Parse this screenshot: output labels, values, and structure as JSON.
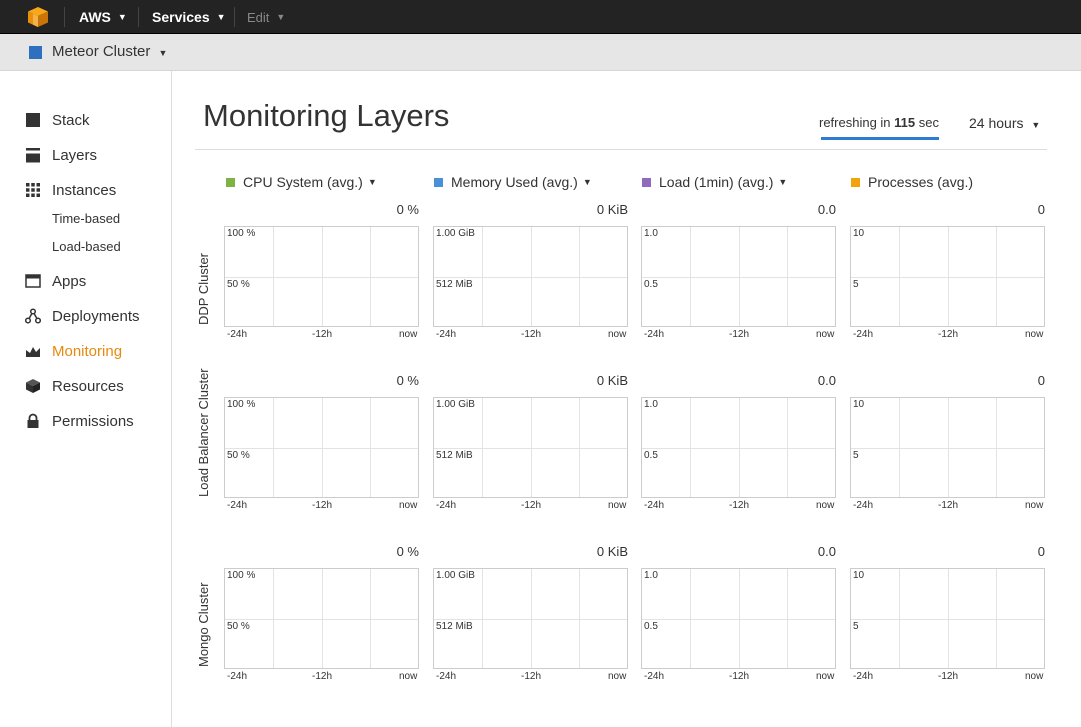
{
  "topbar": {
    "aws_label": "AWS",
    "services_label": "Services",
    "edit_label": "Edit"
  },
  "stack": {
    "name": "Meteor Cluster",
    "color": "#2e6fc0"
  },
  "sidebar": {
    "items": [
      {
        "label": "Stack",
        "icon": "stack-icon"
      },
      {
        "label": "Layers",
        "icon": "layers-icon"
      },
      {
        "label": "Instances",
        "icon": "instances-grid-icon"
      },
      {
        "label": "Apps",
        "icon": "apps-icon"
      },
      {
        "label": "Deployments",
        "icon": "deployments-icon"
      },
      {
        "label": "Monitoring",
        "icon": "monitoring-icon",
        "active": true
      },
      {
        "label": "Resources",
        "icon": "resources-cube-icon"
      },
      {
        "label": "Permissions",
        "icon": "lock-icon"
      }
    ],
    "instances_sub": [
      "Time-based",
      "Load-based"
    ],
    "active_color": "#e7890f"
  },
  "main": {
    "title": "Monitoring Layers",
    "refresh": {
      "prefix": "refreshing in",
      "seconds": "115",
      "suffix": "sec"
    },
    "range": "24 hours"
  },
  "metrics": [
    {
      "label": "CPU System (avg.)",
      "color": "#7cb342",
      "dropdown": true,
      "current": "0 %",
      "y_top": "100 %",
      "y_mid": "50 %"
    },
    {
      "label": "Memory Used (avg.)",
      "color": "#4a90d9",
      "dropdown": true,
      "current": "0 KiB",
      "y_top": "1.00 GiB",
      "y_mid": "512 MiB"
    },
    {
      "label": "Load (1min) (avg.)",
      "color": "#8e6bbf",
      "dropdown": true,
      "current": "0.0",
      "y_top": "1.0",
      "y_mid": "0.5"
    },
    {
      "label": "Processes (avg.)",
      "color": "#f0a30a",
      "dropdown": false,
      "current": "0",
      "y_top": "10",
      "y_mid": "5"
    }
  ],
  "x_ticks": [
    "-24h",
    "-12h",
    "now"
  ],
  "layers": [
    "DDP Cluster",
    "Load Balancer Cluster",
    "Mongo Cluster"
  ]
}
